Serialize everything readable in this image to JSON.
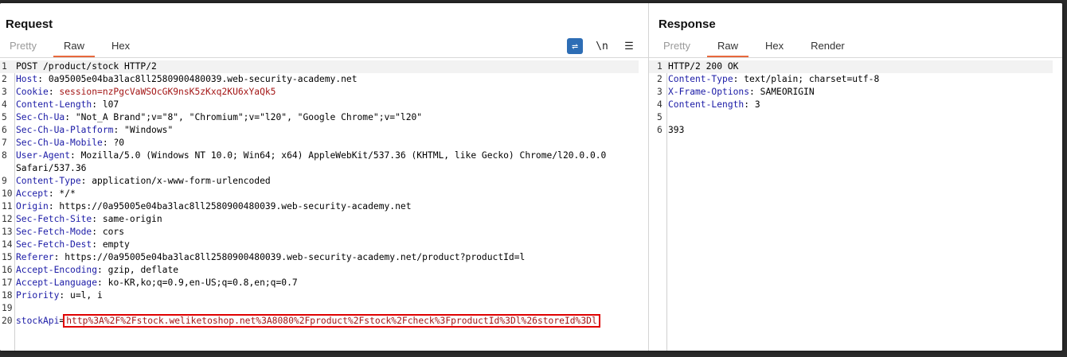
{
  "request": {
    "title": "Request",
    "tabs": [
      "Pretty",
      "Raw",
      "Hex"
    ],
    "active_tab": "Raw",
    "tools": {
      "wrap_icon": "⇌",
      "newline": "\\n",
      "menu_icon": "☰"
    },
    "lines": [
      {
        "n": "1",
        "key": "",
        "sep": "",
        "val": "POST /product/stock HTTP/2"
      },
      {
        "n": "2",
        "key": "Host",
        "sep": ": ",
        "val": "0a95005e04ba3lac8ll2580900480039.web-security-academy.net"
      },
      {
        "n": "3",
        "key": "Cookie",
        "sep": ": ",
        "val": "session=nzPgcVaWSOcGK9nsK5zKxq2KU6xYaQk5"
      },
      {
        "n": "4",
        "key": "Content-Length",
        "sep": ": ",
        "val": "l07"
      },
      {
        "n": "5",
        "key": "Sec-Ch-Ua",
        "sep": ": ",
        "val": "\"Not_A Brand\";v=\"8\", \"Chromium\";v=\"l20\", \"Google Chrome\";v=\"l20\""
      },
      {
        "n": "6",
        "key": "Sec-Ch-Ua-Platform",
        "sep": ": ",
        "val": "\"Windows\""
      },
      {
        "n": "7",
        "key": "Sec-Ch-Ua-Mobile",
        "sep": ": ",
        "val": "?0"
      },
      {
        "n": "8",
        "key": "User-Agent",
        "sep": ": ",
        "val": "Mozilla/5.0 (Windows NT 10.0; Win64; x64) AppleWebKit/537.36 (KHTML, like Gecko) Chrome/l20.0.0.0"
      },
      {
        "n": "",
        "key": "",
        "sep": "",
        "val": "Safari/537.36"
      },
      {
        "n": "9",
        "key": "Content-Type",
        "sep": ": ",
        "val": "application/x-www-form-urlencoded"
      },
      {
        "n": "10",
        "key": "Accept",
        "sep": ": ",
        "val": "*/*"
      },
      {
        "n": "11",
        "key": "Origin",
        "sep": ": ",
        "val": "https://0a95005e04ba3lac8ll2580900480039.web-security-academy.net"
      },
      {
        "n": "12",
        "key": "Sec-Fetch-Site",
        "sep": ": ",
        "val": "same-origin"
      },
      {
        "n": "13",
        "key": "Sec-Fetch-Mode",
        "sep": ": ",
        "val": "cors"
      },
      {
        "n": "14",
        "key": "Sec-Fetch-Dest",
        "sep": ": ",
        "val": "empty"
      },
      {
        "n": "15",
        "key": "Referer",
        "sep": ": ",
        "val": "https://0a95005e04ba3lac8ll2580900480039.web-security-academy.net/product?productId=l"
      },
      {
        "n": "16",
        "key": "Accept-Encoding",
        "sep": ": ",
        "val": "gzip, deflate"
      },
      {
        "n": "17",
        "key": "Accept-Language",
        "sep": ": ",
        "val": "ko-KR,ko;q=0.9,en-US;q=0.8,en;q=0.7"
      },
      {
        "n": "18",
        "key": "Priority",
        "sep": ": ",
        "val": "u=l, i"
      },
      {
        "n": "19",
        "key": "",
        "sep": "",
        "val": ""
      },
      {
        "n": "20",
        "key": "stockApi",
        "sep": "=",
        "val": "http%3A%2F%2Fstock.weliketoshop.net%3A8080%2Fproduct%2Fstock%2Fcheck%3FproductId%3Dl%26storeId%3Dl"
      }
    ]
  },
  "response": {
    "title": "Response",
    "tabs": [
      "Pretty",
      "Raw",
      "Hex",
      "Render"
    ],
    "active_tab": "Raw",
    "lines": [
      {
        "n": "1",
        "key": "",
        "sep": "",
        "val": "HTTP/2 200 OK"
      },
      {
        "n": "2",
        "key": "Content-Type",
        "sep": ": ",
        "val": "text/plain; charset=utf-8"
      },
      {
        "n": "3",
        "key": "X-Frame-Options",
        "sep": ": ",
        "val": "SAMEORIGIN"
      },
      {
        "n": "4",
        "key": "Content-Length",
        "sep": ": ",
        "val": "3"
      },
      {
        "n": "5",
        "key": "",
        "sep": "",
        "val": ""
      },
      {
        "n": "6",
        "key": "",
        "sep": "",
        "val": "393"
      }
    ]
  },
  "colors": {
    "accent": "#e8683c",
    "header_key": "#1a1aa6",
    "highlight_box": "#e00000",
    "cookie_value": "#a31515",
    "wrap_button": "#2d6db5"
  }
}
